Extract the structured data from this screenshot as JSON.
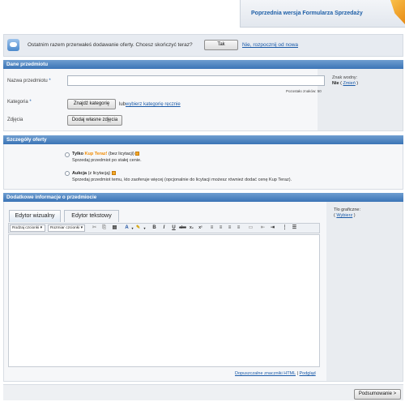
{
  "header": {
    "previous_version_link": "Poprzednia wersja Formularza Sprzedaży"
  },
  "notice": {
    "text": "Ostatnim razem przerwałeś dodawanie oferty. Chcesz skończyć teraz?",
    "yes_label": "Tak",
    "restart_link": "Nie, rozpocznij od nowa"
  },
  "item_section": {
    "title": "Dane przedmiotu",
    "name_label": "Nazwa przedmiotu",
    "required_mark": "*",
    "name_value": "",
    "chars_left": "Pozostało znaków: 50",
    "watermark_label": "Znak wodny:",
    "watermark_value": "Nie",
    "watermark_change_open": "( ",
    "watermark_change": "Zmień",
    "watermark_change_close": " )",
    "category_label": "Kategoria",
    "find_category_button": "Znajdź kategorię",
    "or_text": "lub",
    "choose_manually_link": "wybierz kategorię ręcznie",
    "photos_label": "Zdjęcia",
    "add_photos_button": "Dodaj własne zdjęcia"
  },
  "offer_section": {
    "title": "Szczegóły oferty",
    "buy_now_bold": "Tylko",
    "buy_now_orange": "Kup Teraz!",
    "buy_now_suffix": "(bez licytacji)",
    "buy_now_desc": "Sprzedaj przedmiot po stałej cenie.",
    "auction_bold": "Aukcja",
    "auction_suffix": "(z licytacją)",
    "auction_desc": "Sprzedaj przedmiot temu, kto zaoferuje więcej (opcjonalnie do licytacji możesz również dodać cenę Kup Teraz)."
  },
  "description_section": {
    "title": "Dodatkowe informacje o przedmiocie",
    "tab_visual": "Edytor wizualny",
    "tab_text": "Edytor tekstowy",
    "font_select": "Rodzaj czcionki",
    "size_select": "Rozmiar czcionki",
    "background_label": "Tło graficzne:",
    "background_choose_open": "( ",
    "background_choose": "Wybierz",
    "background_choose_close": " )",
    "allowed_html_link": "Dopuszczalne znaczniki HTML",
    "separator": "|",
    "preview_link": "Podgląd"
  },
  "footer": {
    "summary_button": "Podsumowanie >"
  }
}
